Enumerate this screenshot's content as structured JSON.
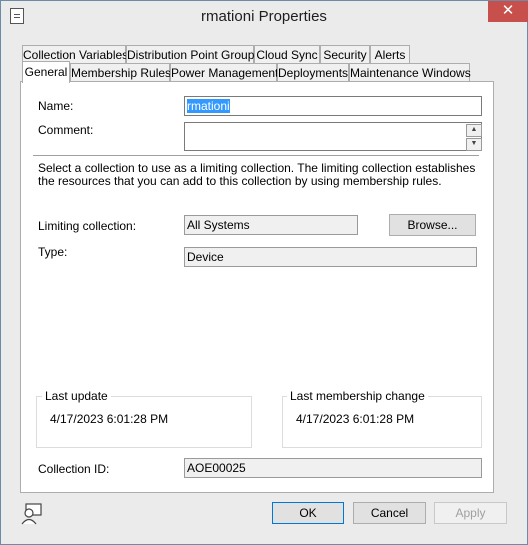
{
  "window": {
    "title": "rmationi Properties",
    "close_glyph": "✕"
  },
  "tabs_row1": [
    "Collection Variables",
    "Distribution Point Groups",
    "Cloud Sync",
    "Security",
    "Alerts"
  ],
  "tabs_row2": [
    "General",
    "Membership Rules",
    "Power Management",
    "Deployments",
    "Maintenance Windows"
  ],
  "general": {
    "name_label": "Name:",
    "name_value": "rmationi",
    "comment_label": "Comment:",
    "comment_value": "",
    "description": "Select a collection to use as a limiting collection. The limiting collection establishes the resources that you can add to this collection by using membership rules.",
    "limiting_label": "Limiting collection:",
    "limiting_value": "All Systems",
    "browse_label": "Browse...",
    "type_label": "Type:",
    "type_value": "Device",
    "last_update_title": "Last update",
    "last_update_value": "4/17/2023 6:01:28 PM",
    "last_change_title": "Last membership change",
    "last_change_value": "4/17/2023 6:01:28 PM",
    "collection_id_label": "Collection ID:",
    "collection_id_value": "AOE00025"
  },
  "footer": {
    "ok": "OK",
    "cancel": "Cancel",
    "apply": "Apply",
    "help_icon": "user-help-icon"
  }
}
